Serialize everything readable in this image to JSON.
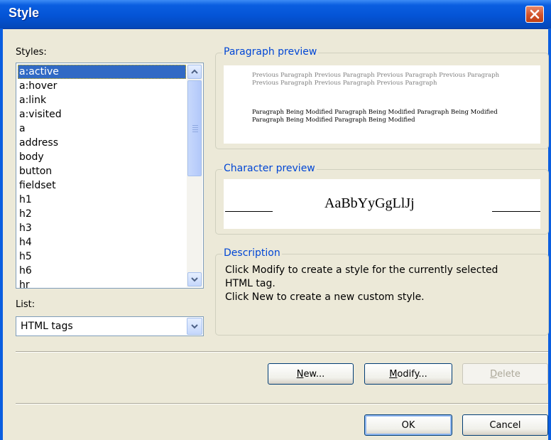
{
  "window": {
    "title": "Style"
  },
  "styles_label": "Styles:",
  "styles": {
    "items": [
      "a:active",
      "a:hover",
      "a:link",
      "a:visited",
      "a",
      "address",
      "body",
      "button",
      "fieldset",
      "h1",
      "h2",
      "h3",
      "h4",
      "h5",
      "h6",
      "hr"
    ],
    "selected": "a:active"
  },
  "list_label": "List:",
  "list_value": "HTML tags",
  "paragraph_preview": {
    "legend": "Paragraph preview",
    "previous_text": "Previous Paragraph Previous Paragraph Previous Paragraph Previous Paragraph Previous Paragraph Previous Paragraph Previous Paragraph",
    "current_text": "Paragraph Being Modified Paragraph Being Modified Paragraph Being Modified Paragraph Being Modified Paragraph Being Modified"
  },
  "character_preview": {
    "legend": "Character preview",
    "sample": "AaBbYyGgLlJj"
  },
  "description": {
    "legend": "Description",
    "line1": "Click Modify to create a style for the currently selected HTML tag.",
    "line2": "Click New to create a new custom style."
  },
  "buttons": {
    "new": "New...",
    "modify": "Modify...",
    "delete": "Delete",
    "ok": "OK",
    "cancel": "Cancel"
  },
  "colors": {
    "title_bar": "#0454d6",
    "selection": "#316ac5",
    "legend_text": "#0046d5",
    "close_button": "#d2532a"
  }
}
